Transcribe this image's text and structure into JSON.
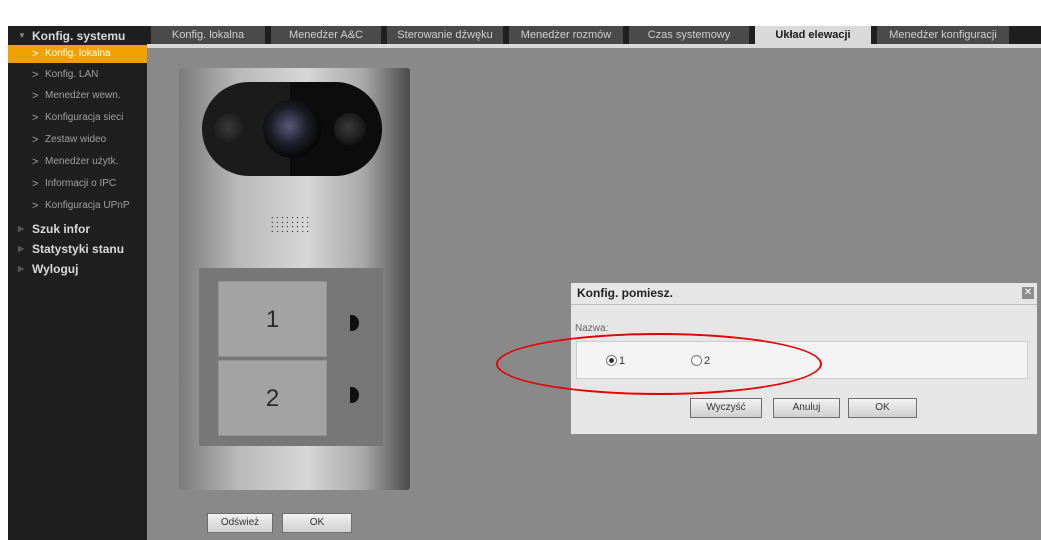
{
  "sidebar": {
    "sections": [
      {
        "label": "Konfig. systemu",
        "expanded": true
      },
      {
        "label": "Szuk infor",
        "expanded": false
      },
      {
        "label": "Statystyki stanu",
        "expanded": false
      },
      {
        "label": "Wyloguj",
        "expanded": false
      }
    ],
    "items": [
      {
        "label": "Konfig. lokalna",
        "active": true
      },
      {
        "label": "Konfig. LAN",
        "active": false
      },
      {
        "label": "Menedżer wewn.",
        "active": false
      },
      {
        "label": "Konfiguracja sieci",
        "active": false
      },
      {
        "label": "Zestaw wideo",
        "active": false
      },
      {
        "label": "Menedżer użytk.",
        "active": false
      },
      {
        "label": "Informacji o IPC",
        "active": false
      },
      {
        "label": "Konfiguracja UPnP",
        "active": false
      }
    ]
  },
  "tabs": [
    {
      "label": "Konfig. lokalna",
      "active": false
    },
    {
      "label": "Menedżer A&C",
      "active": false
    },
    {
      "label": "Sterowanie dźwęku",
      "active": false
    },
    {
      "label": "Menedżer rozmów",
      "active": false
    },
    {
      "label": "Czas systemowy",
      "active": false
    },
    {
      "label": "Układ elewacji",
      "active": true
    },
    {
      "label": "Menedżer konfiguracji",
      "active": false
    }
  ],
  "panel": {
    "rooms": [
      {
        "label": "1"
      },
      {
        "label": "2"
      }
    ],
    "speaker": "::::::::\n::::::::"
  },
  "bottom_buttons": {
    "refresh_label": "Odśwież",
    "ok_label": "OK"
  },
  "dialog": {
    "title": "Konfig. pomiesz.",
    "close_glyph": "✕",
    "name_label": "Nazwa:",
    "options": [
      {
        "label": "1",
        "selected": true
      },
      {
        "label": "2",
        "selected": false
      }
    ],
    "clear_label": "Wyczyść",
    "cancel_label": "Anuluj",
    "ok_label": "OK"
  },
  "colors": {
    "accent": "#f0a000",
    "sidebar_bg": "#1f1f1f",
    "content_bg": "#898989",
    "annotation": "#e60000"
  }
}
